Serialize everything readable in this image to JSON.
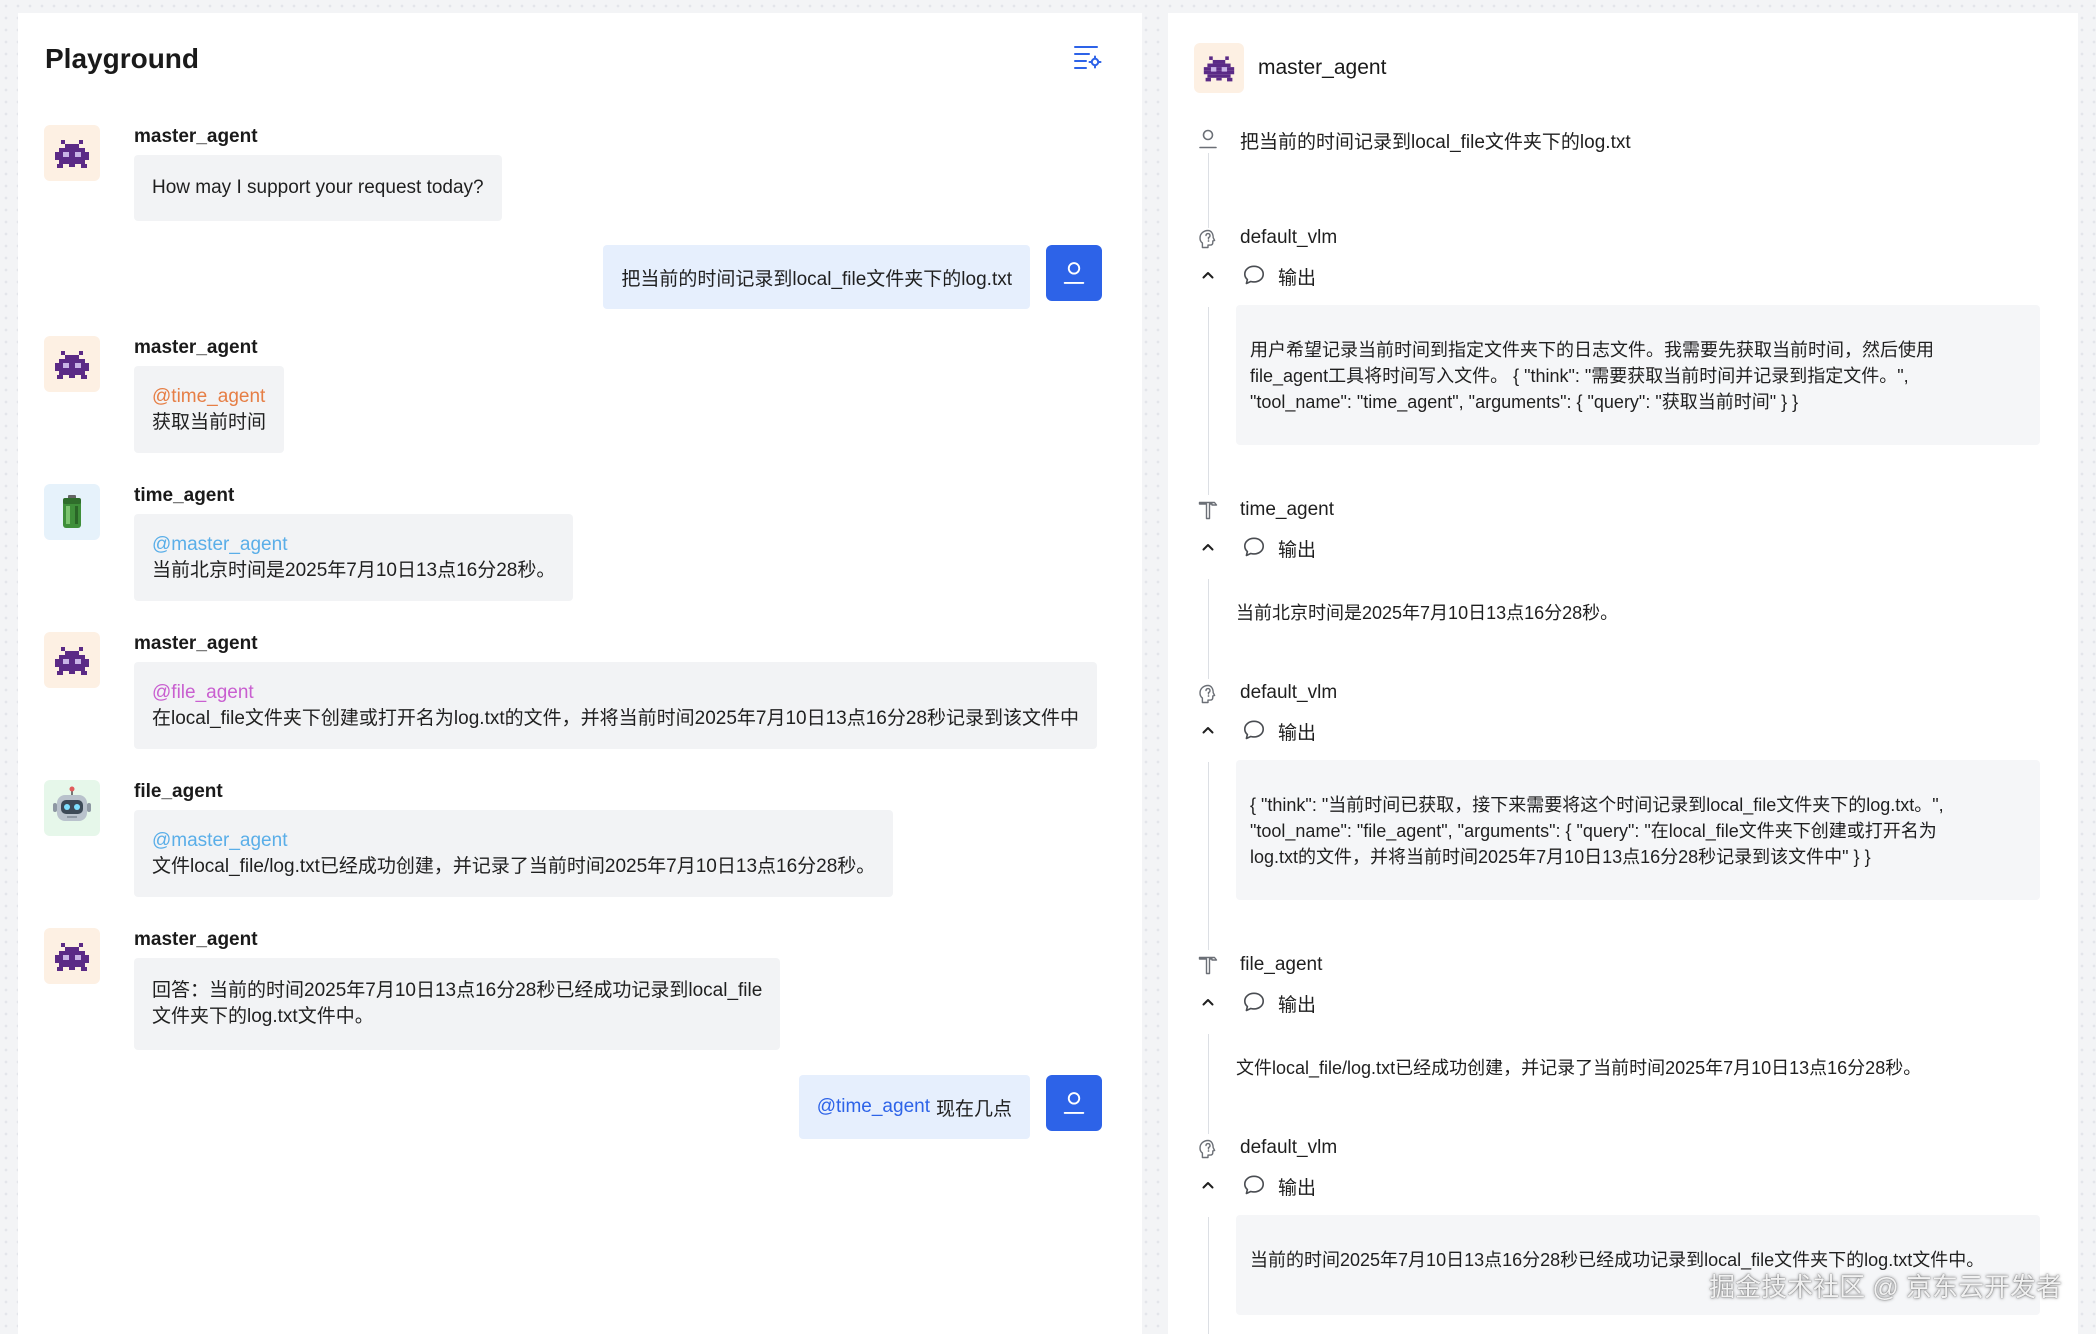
{
  "playground": {
    "title": "Playground",
    "settings_icon": "settings-list-icon",
    "messages": [
      {
        "sender": "master_agent",
        "avatar": "alien-monster-icon",
        "text": "How may I support your request today?"
      },
      {
        "user_text": "把当前的时间记录到local_file文件夹下的log.txt"
      },
      {
        "sender": "master_agent",
        "avatar": "alien-monster-icon",
        "mention": "@time_agent",
        "text": "获取当前时间"
      },
      {
        "sender": "time_agent",
        "avatar": "battery-icon",
        "mention": "@master_agent",
        "text": "当前北京时间是2025年7月10日13点16分28秒。"
      },
      {
        "sender": "master_agent",
        "avatar": "alien-monster-icon",
        "mention": "@file_agent",
        "text": "在local_file文件夹下创建或打开名为log.txt的文件，并将当前时间2025年7月10日13点16分28秒记录到该文件中"
      },
      {
        "sender": "file_agent",
        "avatar": "robot-icon",
        "mention": "@master_agent",
        "text": "文件local_file/log.txt已经成功创建，并记录了当前时间2025年7月10日13点16分28秒。"
      },
      {
        "sender": "master_agent",
        "avatar": "alien-monster-icon",
        "text_line1": "回答：当前的时间2025年7月10日13点16分28秒已经成功记录到local_file",
        "text_line2": "文件夹下的log.txt文件中。"
      },
      {
        "user_mention": "@time_agent",
        "user_text": "现在几点"
      }
    ]
  },
  "trace": {
    "agent_name": "master_agent",
    "query": "把当前的时间记录到local_file文件夹下的log.txt",
    "output_label": "输出",
    "steps": [
      {
        "name": "default_vlm",
        "icon": "brain-icon",
        "output_lines": [
          "用户希望记录当前时间到指定文件夹下的日志文件。我需要先获取当前时间，然后使用",
          "file_agent工具将时间写入文件。 { \"think\": \"需要获取当前时间并记录到指定文件。\",",
          "\"tool_name\": \"time_agent\", \"arguments\": { \"query\": \"获取当前时间\" } }"
        ]
      },
      {
        "name": "time_agent",
        "icon": "hammer-icon",
        "output": "当前北京时间是2025年7月10日13点16分28秒。"
      },
      {
        "name": "default_vlm",
        "icon": "brain-icon",
        "output_lines": [
          "{ \"think\": \"当前时间已获取，接下来需要将这个时间记录到local_file文件夹下的log.txt。\",",
          "\"tool_name\": \"file_agent\", \"arguments\": { \"query\": \"在local_file文件夹下创建或打开名为",
          "log.txt的文件，并将当前时间2025年7月10日13点16分28秒记录到该文件中\" } }"
        ]
      },
      {
        "name": "file_agent",
        "icon": "hammer-icon",
        "output": "文件local_file/log.txt已经成功创建，并记录了当前时间2025年7月10日13点16分28秒。"
      },
      {
        "name": "default_vlm",
        "icon": "brain-icon",
        "output": "当前的时间2025年7月10日13点16分28秒已经成功记录到local_file文件夹下的log.txt文件中。"
      }
    ]
  },
  "watermark": "掘金技术社区 @ 京东云开发者",
  "colors": {
    "mention_time": "#e67e45",
    "mention_master": "#5aaee8",
    "mention_file": "#c95fd0",
    "mention_user": "#2d63e8",
    "user_bubble": "#e6effd",
    "user_avatar": "#2d63e8"
  }
}
